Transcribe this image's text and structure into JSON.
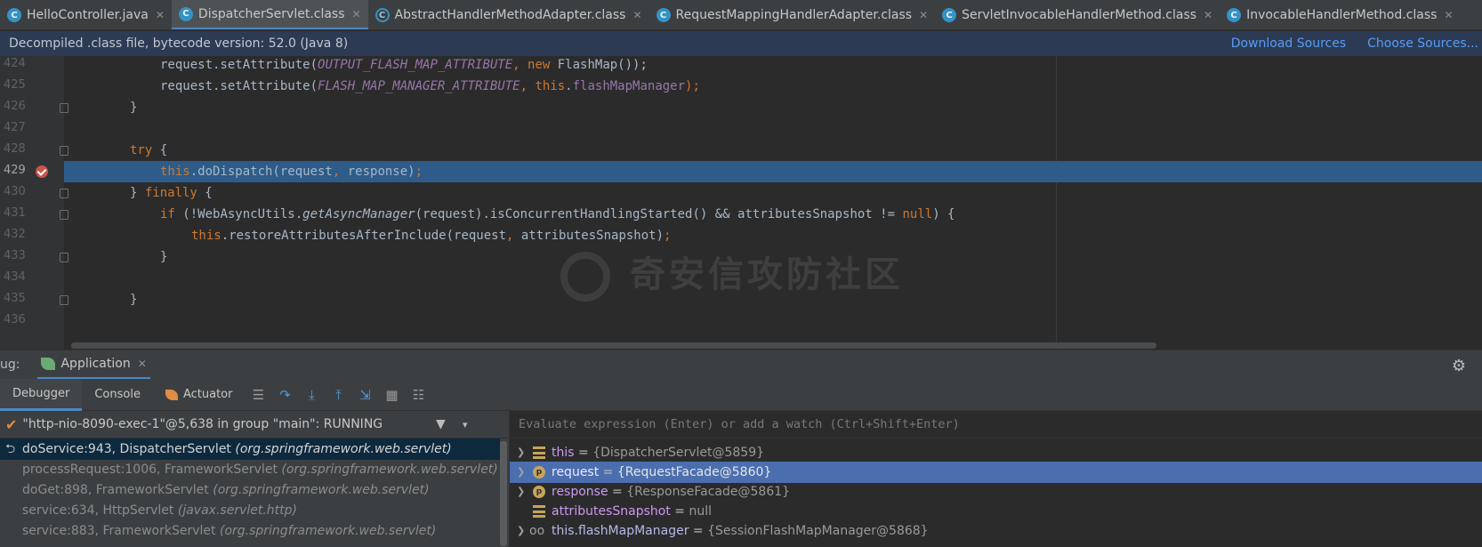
{
  "tabs": [
    {
      "label": "HelloController.java",
      "icon": "class-icon"
    },
    {
      "label": "DispatcherServlet.class",
      "icon": "class-icon",
      "active": true
    },
    {
      "label": "AbstractHandlerMethodAdapter.class",
      "icon": "abstract-class-icon"
    },
    {
      "label": "RequestMappingHandlerAdapter.class",
      "icon": "class-icon"
    },
    {
      "label": "ServletInvocableHandlerMethod.class",
      "icon": "class-icon"
    },
    {
      "label": "InvocableHandlerMethod.class",
      "icon": "class-icon"
    }
  ],
  "banner": {
    "message": "Decompiled .class file, bytecode version: 52.0 (Java 8)",
    "download": "Download Sources",
    "choose": "Choose Sources..."
  },
  "code_lines": [
    {
      "num": "424",
      "tokens": [
        [
          "",
          "request.setAttribute("
        ],
        [
          "ital",
          "OUTPUT_FLASH_MAP_ATTRIBUTE"
        ],
        [
          "kw",
          ", new "
        ],
        [
          "",
          "FlashMap());"
        ]
      ]
    },
    {
      "num": "425",
      "tokens": [
        [
          "",
          "request.setAttribute("
        ],
        [
          "ital",
          "FLASH_MAP_MANAGER_ATTRIBUTE"
        ],
        [
          "kw",
          ", this"
        ],
        [
          "",
          "."
        ],
        [
          "fld",
          "flashMapManager"
        ],
        [
          "kw",
          ");"
        ]
      ]
    },
    {
      "num": "426",
      "tokens": [
        [
          "",
          "}"
        ]
      ]
    },
    {
      "num": "427",
      "tokens": []
    },
    {
      "num": "428",
      "tokens": [
        [
          "kw",
          "try "
        ],
        [
          "",
          "{"
        ]
      ]
    },
    {
      "num": "429",
      "tokens": [
        [
          "kw",
          "this"
        ],
        [
          "",
          ".doDispatch(request"
        ],
        [
          "kw",
          ", "
        ],
        [
          "",
          "response)"
        ],
        [
          "kw",
          ";"
        ]
      ]
    },
    {
      "num": "430",
      "tokens": [
        [
          "",
          "} "
        ],
        [
          "kw",
          "finally "
        ],
        [
          "",
          "{"
        ]
      ]
    },
    {
      "num": "431",
      "tokens": [
        [
          "kw",
          "if "
        ],
        [
          "",
          "(!WebAsyncUtils."
        ],
        [
          "mth",
          "getAsyncManager"
        ],
        [
          "",
          "(request).isConcurrentHandlingStarted() && attributesSnapshot != "
        ],
        [
          "kw",
          "null"
        ],
        [
          "",
          ") {"
        ]
      ]
    },
    {
      "num": "432",
      "tokens": [
        [
          "kw",
          "this"
        ],
        [
          "",
          ".restoreAttributesAfterInclude(request"
        ],
        [
          "kw",
          ", "
        ],
        [
          "",
          "attributesSnapshot)"
        ],
        [
          "kw",
          ";"
        ]
      ]
    },
    {
      "num": "433",
      "tokens": [
        [
          "",
          "}"
        ]
      ]
    },
    {
      "num": "434",
      "tokens": []
    },
    {
      "num": "435",
      "tokens": [
        [
          "",
          "}"
        ]
      ]
    },
    {
      "num": "436",
      "tokens": []
    }
  ],
  "watermark": "奇安信攻防社区",
  "debug": {
    "label": "ug:",
    "app_tab": "Application",
    "tabs": [
      "Debugger",
      "Console",
      "Actuator"
    ],
    "thread": "\"http-nio-8090-exec-1\"@5,638 in group \"main\": RUNNING",
    "frames": [
      {
        "method": "doService:943, DispatcherServlet",
        "pkg": "(org.springframework.web.servlet)"
      },
      {
        "method": "processRequest:1006, FrameworkServlet",
        "pkg": "(org.springframework.web.servlet)"
      },
      {
        "method": "doGet:898, FrameworkServlet",
        "pkg": "(org.springframework.web.servlet)"
      },
      {
        "method": "service:634, HttpServlet",
        "pkg": "(javax.servlet.http)"
      },
      {
        "method": "service:883, FrameworkServlet",
        "pkg": "(org.springframework.web.servlet)"
      }
    ],
    "eval_placeholder": "Evaluate expression (Enter) or add a watch (Ctrl+Shift+Enter)",
    "variables": [
      {
        "name": "this",
        "value": "{DispatcherServlet@5859}",
        "icon": "field-icon",
        "expandable": true
      },
      {
        "name": "request",
        "value": "{RequestFacade@5860}",
        "icon": "parameter-icon",
        "expandable": true,
        "selected": true
      },
      {
        "name": "response",
        "value": "{ResponseFacade@5861}",
        "icon": "parameter-icon",
        "expandable": true
      },
      {
        "name": "attributesSnapshot",
        "value": "null",
        "icon": "field-icon",
        "expandable": false
      },
      {
        "name": "this.flashMapManager",
        "value": "{SessionFlashMapManager@5868}",
        "icon": "watch-icon",
        "expandable": true
      }
    ]
  },
  "colors": {
    "accent": "#4a88c7",
    "selection": "#2d5c8a",
    "breakpoint": "#c75450",
    "keyword": "#cc7832",
    "field": "#9876aa"
  }
}
